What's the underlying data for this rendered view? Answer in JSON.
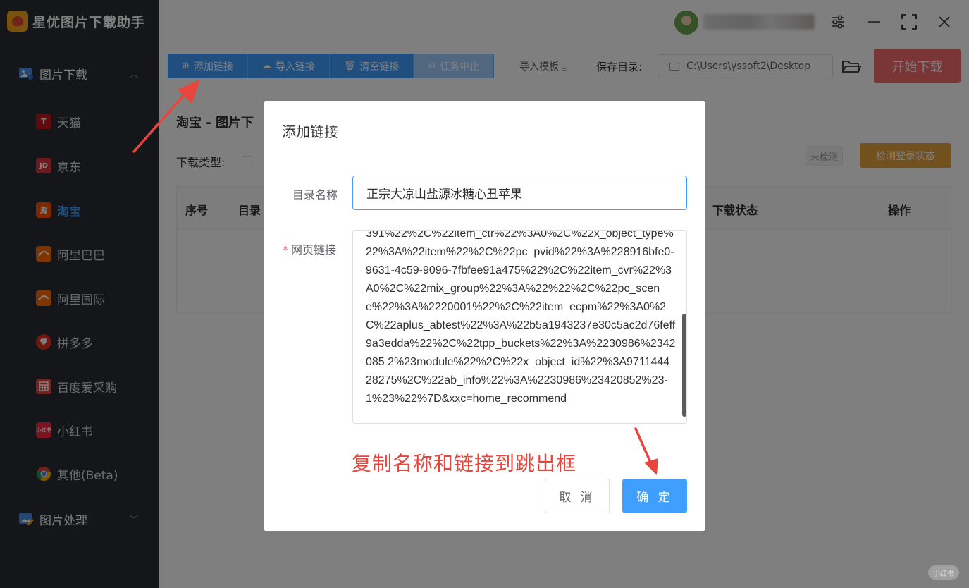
{
  "app": {
    "name": "星优图片下载助手"
  },
  "sidebar": {
    "groups": [
      {
        "label": "图片下载",
        "icon": "image-download-icon"
      },
      {
        "label": "图片处理",
        "icon": "image-edit-icon"
      }
    ],
    "items": [
      {
        "label": "天猫",
        "icon_text": "T",
        "color": "#c4161c",
        "active": false
      },
      {
        "label": "京东",
        "icon_text": "JD",
        "color": "#d9363e",
        "active": false
      },
      {
        "label": "淘宝",
        "icon_text": "淘",
        "color": "#ff5000",
        "active": true
      },
      {
        "label": "阿里巴巴",
        "icon_text": "",
        "color": "#ff6a00",
        "active": false
      },
      {
        "label": "阿里国际",
        "icon_text": "",
        "color": "#ff6a00",
        "active": false
      },
      {
        "label": "拼多多",
        "icon_text": "",
        "color": "#e02e24",
        "active": false
      },
      {
        "label": "百度爱采购",
        "icon_text": "",
        "color": "#e8453c",
        "active": false
      },
      {
        "label": "小红书",
        "icon_text": "小红书",
        "color": "#ff2442",
        "active": false
      },
      {
        "label": "其他(Beta)",
        "icon_text": "",
        "color": "#4285f4",
        "active": false
      }
    ]
  },
  "toolbar": {
    "add_link": "添加链接",
    "import_link": "导入链接",
    "clear_link": "清空链接",
    "stop_task": "任务中止",
    "import_template": "导入模板",
    "save_dir_label": "保存目录:",
    "save_dir_value": "C:\\Users\\yssoft2\\Desktop",
    "start_download": "开始下载"
  },
  "main": {
    "page_title": "淘宝 - 图片下",
    "download_type_label": "下载类型:",
    "login_status": "未检测",
    "check_login": "检测登录状态",
    "table_headers": [
      "序号",
      "目录",
      "下载状态",
      "操作"
    ]
  },
  "dialog": {
    "title": "添加链接",
    "name_label": "目录名称",
    "name_value": "正宗大凉山盐源冰糖心丑苹果",
    "url_label": "网页链接",
    "required_mark": "*",
    "url_value": "391%22%2C%22item_ctr%22%3A0%2C%22x_object_type%22%3A%22item%22%2C%22pc_pvid%22%3A%228916bfe0-9631-4c59-9096-7fbfee91a475%22%2C%22item_cvr%22%3A0%2C%22mix_group%22%3A%22%22%2C%22pc_scene%22%3A%2220001%22%2C%22item_ecpm%22%3A0%2C%22aplus_abtest%22%3A%22b5a1943237e30c5ac2d76feff9a3edda%22%2C%22tpp_buckets%22%3A%2230986%2342085 2%23module%22%2C%22x_object_id%22%3A971144428275%2C%22ab_info%22%3A%2230986%23420852%23-1%23%22%7D&xxc=home_recommend",
    "cancel": "取 消",
    "confirm": "确 定"
  },
  "annotation": {
    "text": "复制名称和链接到跳出框",
    "color": "#e8453c"
  },
  "watermark": "小红书",
  "colors": {
    "primary": "#409eff",
    "danger": "#f56c6c",
    "warning": "#e6a23c",
    "sidebar_bg": "#2b2d33"
  }
}
